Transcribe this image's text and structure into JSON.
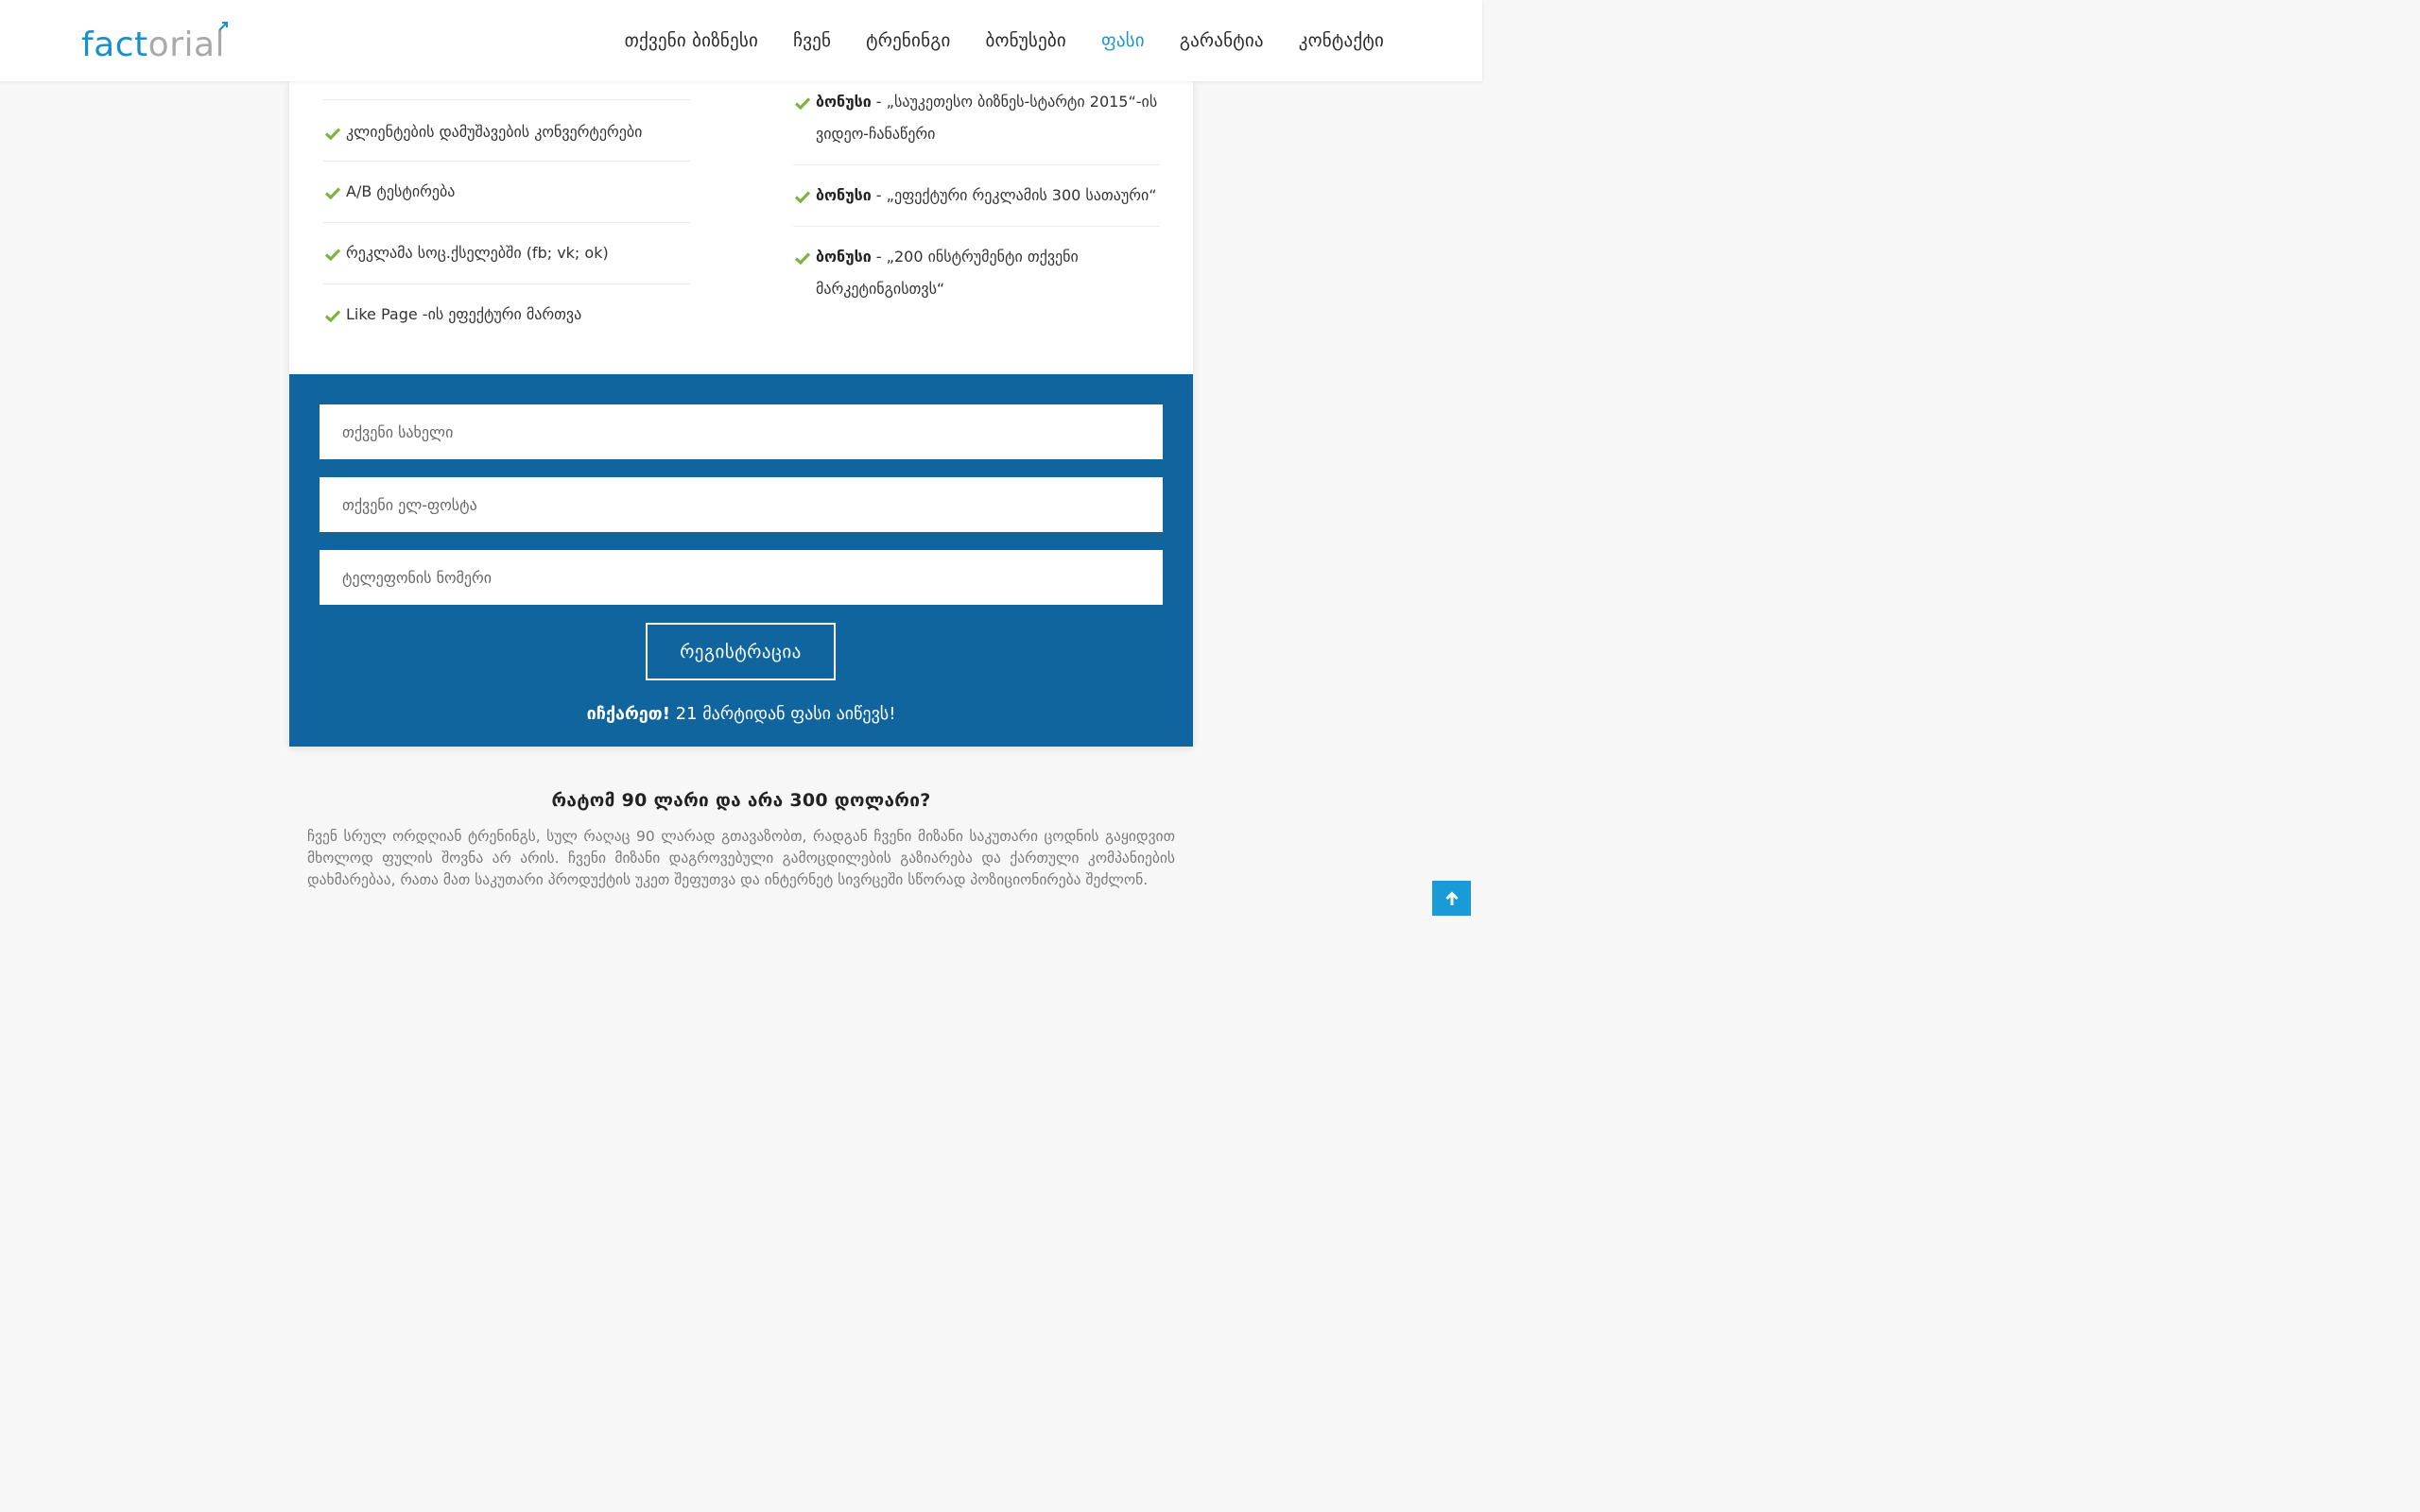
{
  "header": {
    "logo": {
      "part_a": "fact",
      "part_b": "o",
      "part_c": "rial",
      "accent_color": "#1a90c8",
      "muted_color": "#a9a9a9"
    },
    "nav": [
      {
        "label": "თქვენი ბიზნესი",
        "active": false
      },
      {
        "label": "ჩვენ",
        "active": false
      },
      {
        "label": "ტრენინგი",
        "active": false
      },
      {
        "label": "ბონუსები",
        "active": false
      },
      {
        "label": "ფასი",
        "active": true
      },
      {
        "label": "გარანტია",
        "active": false
      },
      {
        "label": "კონტაქტი",
        "active": false
      }
    ]
  },
  "features_left": [
    "კლიენტების დამუშავების კონვერტერები",
    "A/B ტესტირება",
    "რეკლამა სოც.ქსელებში (fb; vk; ok)",
    "Like Page -ის ეფექტური მართვა"
  ],
  "features_right": [
    {
      "bold": "ბონუსი",
      "text": " - „საუკეთესო ბიზნეს-სტარტი 2015“-ის ვიდეო-ჩანაწერი"
    },
    {
      "bold": "ბონუსი",
      "text": " - „ეფექტური რეკლამის 300 სათაური“"
    },
    {
      "bold": "ბონუსი",
      "text": " - „200 ინსტრუმენტი თქვენი მარკეტინგისთვს“"
    }
  ],
  "form": {
    "name_placeholder": "თქვენი სახელი",
    "email_placeholder": "თქვენი ელ-ფოსტა",
    "phone_placeholder": "ტელეფონის ნომერი",
    "submit_label": "რეგისტრაცია",
    "deadline_bold": "იჩქარეთ!",
    "deadline_text": " 21 მარტიდან ფასი აიწევს!"
  },
  "why": {
    "title": "რატომ 90 ლარი და არა 300 დოლარი?",
    "text": "ჩვენ სრულ ორდღიან ტრენინგს, სულ რაღაც 90 ლარად გთავაზობთ, რადგან ჩვენი მიზანი საკუთარი ცოდნის გაყიდვით მხოლოდ ფულის შოვნა არ არის. ჩვენი მიზანი დაგროვებული გამოცდილების გაზიარება და ქართული კომპანიების დახმარებაა, რათა მათ საკუთარი პროდუქტის უკეთ შეფუთვა და ინტერნეტ სივრცეში სწორად პოზიციონირება შეძლონ."
  },
  "icons": {
    "check": "check-icon",
    "scroll_top": "arrow-up-icon"
  },
  "colors": {
    "primary_blue": "#11659f",
    "check_green": "#7cb342",
    "link_active": "#1a95cf"
  }
}
